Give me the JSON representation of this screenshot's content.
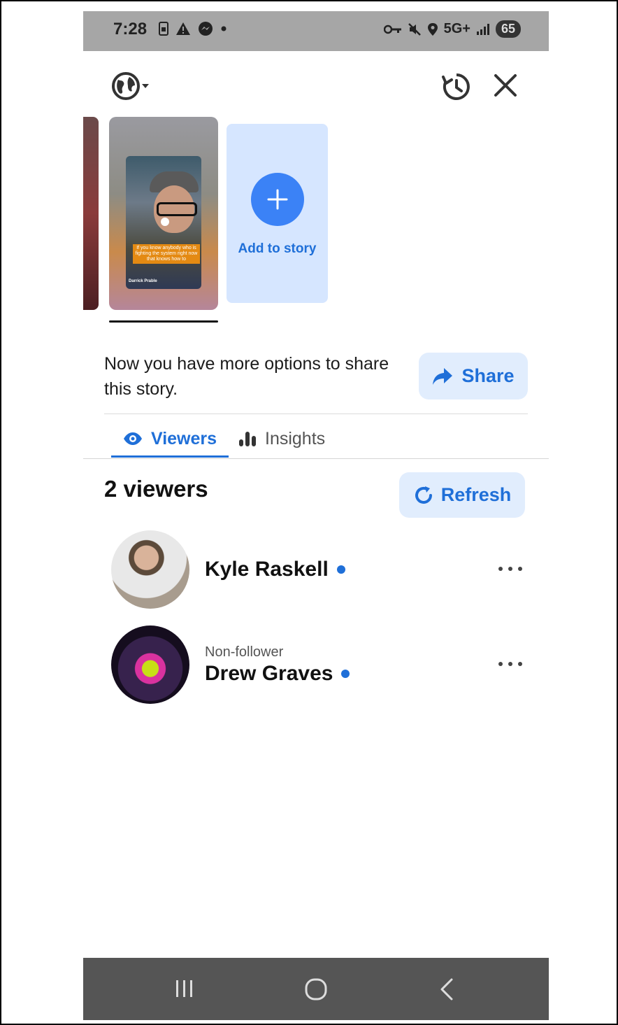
{
  "status_bar": {
    "time": "7:28",
    "network": "5G+",
    "battery": "65",
    "left_icons": [
      "sim-icon",
      "warning-icon",
      "messenger-icon",
      "dot-icon"
    ],
    "right_icons": [
      "key-icon",
      "mute-icon",
      "location-icon",
      "signal-icon",
      "battery-icon"
    ]
  },
  "top_bar": {
    "privacy_icon": "globe-icon",
    "history_icon": "story-archive-icon",
    "close_icon": "close-icon"
  },
  "story": {
    "caption": "If you know anybody who is fighting the system right now that knows how to",
    "author": "Darrick Prable"
  },
  "add_story": {
    "label": "Add to story"
  },
  "share_prompt": {
    "text": "Now you have more options to share this story.",
    "button_label": "Share"
  },
  "tabs": [
    {
      "label": "Viewers",
      "icon": "eye-icon",
      "active": true
    },
    {
      "label": "Insights",
      "icon": "bar-chart-icon",
      "active": false
    }
  ],
  "viewers_section": {
    "count_label": "2 viewers",
    "refresh_label": "Refresh"
  },
  "viewers": [
    {
      "name": "Kyle Raskell",
      "subtitle": "",
      "online": true
    },
    {
      "name": "Drew Graves",
      "subtitle": "Non-follower",
      "online": true
    }
  ],
  "colors": {
    "accent": "#1f6fd8",
    "button_bg": "#e1edfd",
    "add_story_bg": "#d6e6ff",
    "status_bar": "#a6a6a6",
    "nav_bar": "#555555"
  }
}
